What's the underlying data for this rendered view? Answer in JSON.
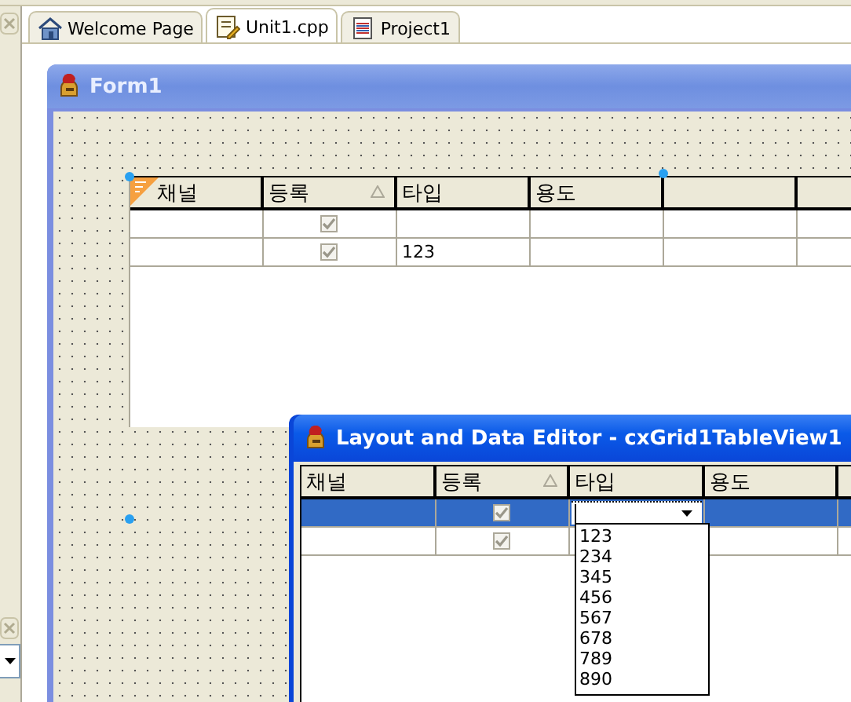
{
  "ide_tabs": [
    {
      "label": "Welcome Page",
      "kind": "home",
      "selected": false
    },
    {
      "label": "Unit1.cpp",
      "kind": "unit",
      "selected": true
    },
    {
      "label": "Project1",
      "kind": "project",
      "selected": false
    }
  ],
  "form": {
    "title": "Form1",
    "grid": {
      "columns": [
        {
          "label": "채널",
          "sorted": false
        },
        {
          "label": "등록",
          "sorted": true
        },
        {
          "label": "타입",
          "sorted": false
        },
        {
          "label": "용도",
          "sorted": false
        }
      ],
      "rows": [
        {
          "checked": true
        },
        {
          "checked": true,
          "type": "123"
        }
      ]
    }
  },
  "editor": {
    "title": "Layout and Data Editor - cxGrid1TableView1",
    "grid": {
      "columns": [
        {
          "label": "채널",
          "sorted": false
        },
        {
          "label": "등록",
          "sorted": true
        },
        {
          "label": "타입",
          "sorted": false
        },
        {
          "label": "용도",
          "sorted": false
        }
      ],
      "rows": [
        {
          "checked": true,
          "selected": true
        },
        {
          "checked": true,
          "selected": false
        }
      ],
      "type_options": [
        "123",
        "234",
        "345",
        "456",
        "567",
        "678",
        "789",
        "890"
      ]
    }
  }
}
